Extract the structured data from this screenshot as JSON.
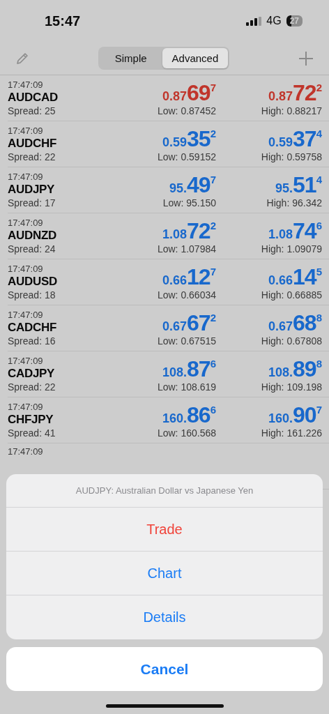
{
  "status_bar": {
    "time": "15:47",
    "network": "4G",
    "battery": "27"
  },
  "segments": [
    {
      "label": "Simple",
      "selected": false
    },
    {
      "label": "Advanced",
      "selected": true
    }
  ],
  "quotes": [
    {
      "time": "17:47:09",
      "symbol": "AUDCAD",
      "spread": "Spread: 25",
      "color": "#c0352b",
      "bid": {
        "prefix": "0.87",
        "big": "69",
        "sup": "7"
      },
      "ask": {
        "prefix": "0.87",
        "big": "72",
        "sup": "2"
      },
      "low": "Low: 0.87452",
      "high": "High: 0.88217"
    },
    {
      "time": "17:47:09",
      "symbol": "AUDCHF",
      "spread": "Spread: 22",
      "color": "#1868cc",
      "bid": {
        "prefix": "0.59",
        "big": "35",
        "sup": "2"
      },
      "ask": {
        "prefix": "0.59",
        "big": "37",
        "sup": "4"
      },
      "low": "Low: 0.59152",
      "high": "High: 0.59758"
    },
    {
      "time": "17:47:09",
      "symbol": "AUDJPY",
      "spread": "Spread: 17",
      "color": "#1868cc",
      "bid": {
        "prefix": "95.",
        "big": "49",
        "sup": "7"
      },
      "ask": {
        "prefix": "95.",
        "big": "51",
        "sup": "4"
      },
      "low": "Low: 95.150",
      "high": "High: 96.342"
    },
    {
      "time": "17:47:09",
      "symbol": "AUDNZD",
      "spread": "Spread: 24",
      "color": "#1868cc",
      "bid": {
        "prefix": "1.08",
        "big": "72",
        "sup": "2"
      },
      "ask": {
        "prefix": "1.08",
        "big": "74",
        "sup": "6"
      },
      "low": "Low: 1.07984",
      "high": "High: 1.09079"
    },
    {
      "time": "17:47:09",
      "symbol": "AUDUSD",
      "spread": "Spread: 18",
      "color": "#1868cc",
      "bid": {
        "prefix": "0.66",
        "big": "12",
        "sup": "7"
      },
      "ask": {
        "prefix": "0.66",
        "big": "14",
        "sup": "5"
      },
      "low": "Low: 0.66034",
      "high": "High: 0.66885"
    },
    {
      "time": "17:47:09",
      "symbol": "CADCHF",
      "spread": "Spread: 16",
      "color": "#1868cc",
      "bid": {
        "prefix": "0.67",
        "big": "67",
        "sup": "2"
      },
      "ask": {
        "prefix": "0.67",
        "big": "68",
        "sup": "8"
      },
      "low": "Low: 0.67515",
      "high": "High: 0.67808"
    },
    {
      "time": "17:47:09",
      "symbol": "CADJPY",
      "spread": "Spread: 22",
      "color": "#1868cc",
      "bid": {
        "prefix": "108.",
        "big": "87",
        "sup": "6"
      },
      "ask": {
        "prefix": "108.",
        "big": "89",
        "sup": "8"
      },
      "low": "Low: 108.619",
      "high": "High: 109.198"
    },
    {
      "time": "17:47:09",
      "symbol": "CHFJPY",
      "spread": "Spread: 41",
      "color": "#1868cc",
      "bid": {
        "prefix": "160.",
        "big": "86",
        "sup": "6"
      },
      "ask": {
        "prefix": "160.",
        "big": "90",
        "sup": "7"
      },
      "low": "Low: 160.568",
      "high": "High: 161.226"
    },
    {
      "time": "17:47:09"
    }
  ],
  "action_sheet": {
    "title": "AUDJPY: Australian Dollar vs Japanese Yen",
    "actions": [
      {
        "label": "Trade",
        "kind": "destructive"
      },
      {
        "label": "Chart",
        "kind": "default"
      },
      {
        "label": "Details",
        "kind": "default"
      }
    ],
    "cancel": "Cancel"
  }
}
